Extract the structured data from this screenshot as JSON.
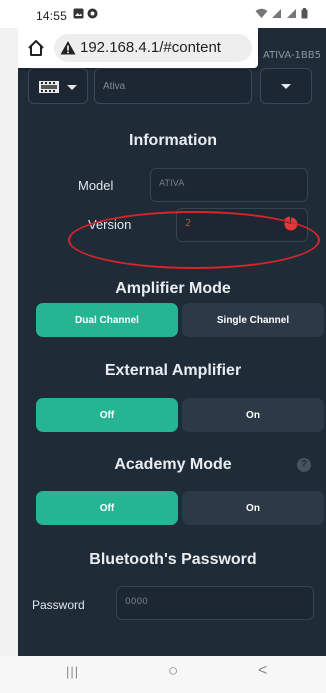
{
  "status_bar": {
    "time": "14:55",
    "notification_icons": [
      "image-icon",
      "dot-icon"
    ],
    "system_icons": [
      "wifi-icon",
      "signal-icon",
      "signal-icon",
      "battery-icon"
    ]
  },
  "browser": {
    "url": "192.168.4.1/#content",
    "security_icon": "warning-icon",
    "home_icon": "home-icon"
  },
  "header": {
    "device_tag": "ATIVA-1BB5",
    "name_value": "Ativa"
  },
  "information": {
    "title": "Information",
    "model_label": "Model",
    "model_value": "ATIVA",
    "version_label": "Version",
    "version_value": "2"
  },
  "amplifier_mode": {
    "title": "Amplifier Mode",
    "options": [
      "Dual Channel",
      "Single Channel"
    ],
    "selected": "Dual Channel"
  },
  "external_amplifier": {
    "title": "External Amplifier",
    "options": [
      "Off",
      "On"
    ],
    "selected": "Off"
  },
  "academy_mode": {
    "title": "Academy Mode",
    "help_icon": "?",
    "options": [
      "Off",
      "On"
    ],
    "selected": "Off"
  },
  "bluetooth": {
    "title": "Bluetooth's Password",
    "password_label": "Password",
    "password_placeholder": "0000"
  },
  "colors": {
    "background": "#1f2b37",
    "accent": "#25b592",
    "inactive_button": "#2d3946",
    "annotation": "#d8242a",
    "version_text": "#e23a3a"
  },
  "nav_bar": {
    "recents": "|||",
    "home": "○",
    "back": "<"
  }
}
